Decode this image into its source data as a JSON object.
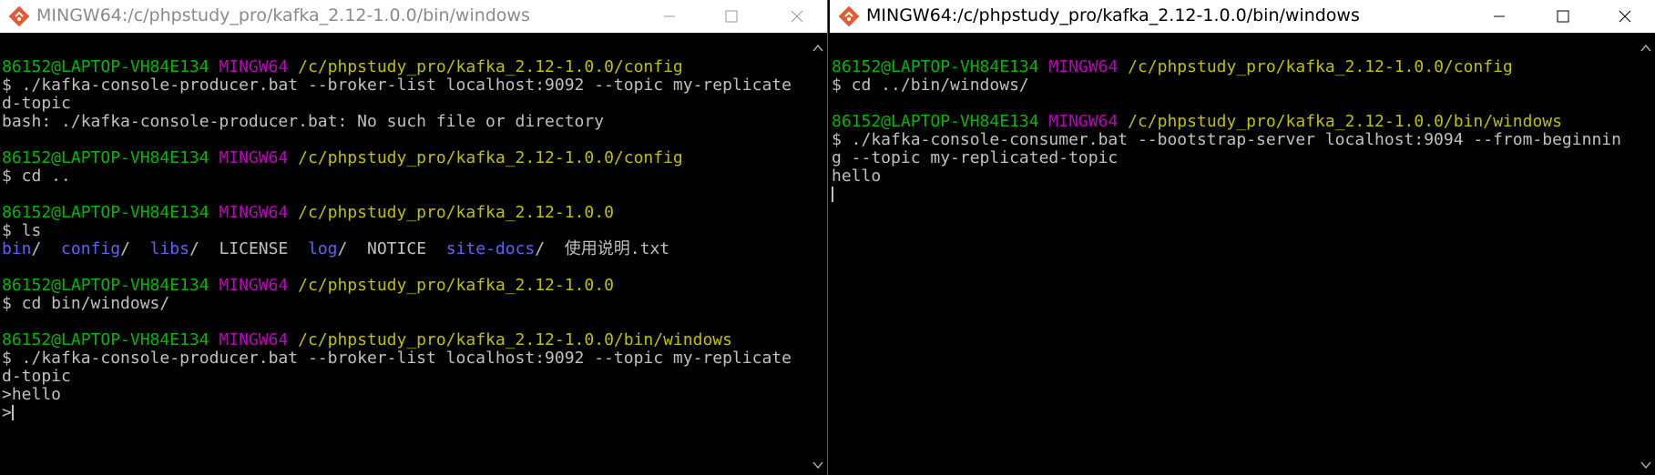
{
  "windows": [
    {
      "title": "MINGW64:/c/phpstudy_pro/kafka_2.12-1.0.0/bin/windows",
      "lines": [
        [],
        [
          {
            "c": "u",
            "t": "86152@LAPTOP-VH84E134 "
          },
          {
            "c": "m",
            "t": "MINGW64 "
          },
          {
            "c": "p",
            "t": "/c/phpstudy_pro/kafka_2.12-1.0.0/config"
          }
        ],
        [
          {
            "c": "w",
            "t": "$ ./kafka-console-producer.bat --broker-list localhost:9092 --topic my-replicate"
          }
        ],
        [
          {
            "c": "w",
            "t": "d-topic"
          }
        ],
        [
          {
            "c": "w",
            "t": "bash: ./kafka-console-producer.bat: No such file or directory"
          }
        ],
        [],
        [
          {
            "c": "u",
            "t": "86152@LAPTOP-VH84E134 "
          },
          {
            "c": "m",
            "t": "MINGW64 "
          },
          {
            "c": "p",
            "t": "/c/phpstudy_pro/kafka_2.12-1.0.0/config"
          }
        ],
        [
          {
            "c": "w",
            "t": "$ cd .."
          }
        ],
        [],
        [
          {
            "c": "u",
            "t": "86152@LAPTOP-VH84E134 "
          },
          {
            "c": "m",
            "t": "MINGW64 "
          },
          {
            "c": "p",
            "t": "/c/phpstudy_pro/kafka_2.12-1.0.0"
          }
        ],
        [
          {
            "c": "w",
            "t": "$ ls"
          }
        ],
        [
          {
            "c": "d",
            "t": "bin"
          },
          {
            "c": "w",
            "t": "/  "
          },
          {
            "c": "d",
            "t": "config"
          },
          {
            "c": "w",
            "t": "/  "
          },
          {
            "c": "d",
            "t": "libs"
          },
          {
            "c": "w",
            "t": "/  LICENSE  "
          },
          {
            "c": "d",
            "t": "log"
          },
          {
            "c": "w",
            "t": "/  NOTICE  "
          },
          {
            "c": "d",
            "t": "site-docs"
          },
          {
            "c": "w",
            "t": "/  使用说明.txt"
          }
        ],
        [],
        [
          {
            "c": "u",
            "t": "86152@LAPTOP-VH84E134 "
          },
          {
            "c": "m",
            "t": "MINGW64 "
          },
          {
            "c": "p",
            "t": "/c/phpstudy_pro/kafka_2.12-1.0.0"
          }
        ],
        [
          {
            "c": "w",
            "t": "$ cd bin/windows/"
          }
        ],
        [],
        [
          {
            "c": "u",
            "t": "86152@LAPTOP-VH84E134 "
          },
          {
            "c": "m",
            "t": "MINGW64 "
          },
          {
            "c": "p",
            "t": "/c/phpstudy_pro/kafka_2.12-1.0.0/bin/windows"
          }
        ],
        [
          {
            "c": "w",
            "t": "$ ./kafka-console-producer.bat --broker-list localhost:9092 --topic my-replicate"
          }
        ],
        [
          {
            "c": "w",
            "t": "d-topic"
          }
        ],
        [
          {
            "c": "w",
            "t": ">hello"
          }
        ],
        [
          {
            "c": "w",
            "t": ">"
          },
          {
            "cursor": true
          }
        ]
      ]
    },
    {
      "title": "MINGW64:/c/phpstudy_pro/kafka_2.12-1.0.0/bin/windows",
      "lines": [
        [],
        [
          {
            "c": "u",
            "t": "86152@LAPTOP-VH84E134 "
          },
          {
            "c": "m",
            "t": "MINGW64 "
          },
          {
            "c": "p",
            "t": "/c/phpstudy_pro/kafka_2.12-1.0.0/config"
          }
        ],
        [
          {
            "c": "w",
            "t": "$ cd ../bin/windows/"
          }
        ],
        [],
        [
          {
            "c": "u",
            "t": "86152@LAPTOP-VH84E134 "
          },
          {
            "c": "m",
            "t": "MINGW64 "
          },
          {
            "c": "p",
            "t": "/c/phpstudy_pro/kafka_2.12-1.0.0/bin/windows"
          }
        ],
        [
          {
            "c": "w",
            "t": "$ ./kafka-console-consumer.bat --bootstrap-server localhost:9094 --from-beginnin"
          }
        ],
        [
          {
            "c": "w",
            "t": "g --topic my-replicated-topic"
          }
        ],
        [
          {
            "c": "w",
            "t": "hello"
          }
        ],
        [
          {
            "cursor": true
          }
        ]
      ]
    }
  ]
}
